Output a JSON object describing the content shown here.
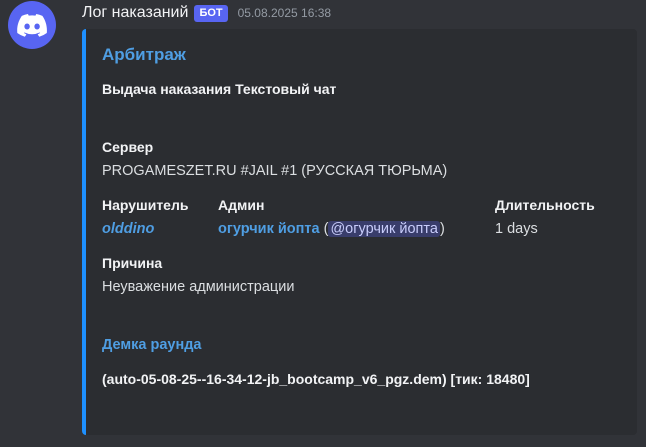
{
  "message": {
    "username": "Лог наказаний",
    "bot_tag": "БОТ",
    "timestamp": "05.08.2025 16:38",
    "avatar_icon": "discord-logo-icon"
  },
  "embed": {
    "accent_color": "#1e90ff",
    "author": "Арбитраж",
    "title": "Выдача наказания Текстовый чат",
    "server": {
      "name": "Сервер",
      "value": "PROGAMESZET.RU #JAIL #1 (РУССКАЯ ТЮРЬМА)"
    },
    "violator": {
      "name": "Нарушитель",
      "value": "olddino"
    },
    "admin": {
      "name": "Админ",
      "value": "огурчик йопта",
      "open_paren": "(",
      "mention": "@огурчик йопта",
      "close_paren": ")"
    },
    "duration": {
      "name": "Длительность",
      "value": "1 days"
    },
    "reason": {
      "name": "Причина",
      "value": "Неуважение администрации"
    },
    "demo": {
      "title": "Демка раунда",
      "value": "(auto-05-08-25--16-34-12-jb_bootcamp_v6_pgz.dem) [тик: 18480]"
    }
  }
}
